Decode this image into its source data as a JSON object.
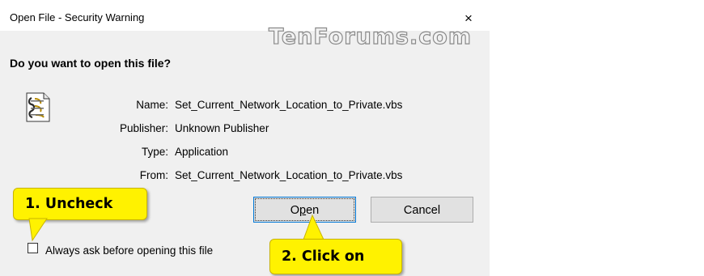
{
  "dialog": {
    "title": "Open File - Security Warning",
    "close_glyph": "×",
    "watermark": "TenForums.com",
    "question": "Do you want to open this file?",
    "fields": [
      {
        "label": "Name:",
        "value": "Set_Current_Network_Location_to_Private.vbs"
      },
      {
        "label": "Publisher:",
        "value": "Unknown Publisher"
      },
      {
        "label": "Type:",
        "value": "Application"
      },
      {
        "label": "From:",
        "value": "Set_Current_Network_Location_to_Private.vbs"
      }
    ],
    "open_prefix": "O",
    "open_mnemonic": "p",
    "open_suffix": "en",
    "cancel_label": "Cancel",
    "checkbox_label": "Always ask before opening this file",
    "checkbox_checked": false
  },
  "annotations": {
    "step1": "1. Uncheck",
    "step2": "2. Click on",
    "color": "#fff200"
  }
}
